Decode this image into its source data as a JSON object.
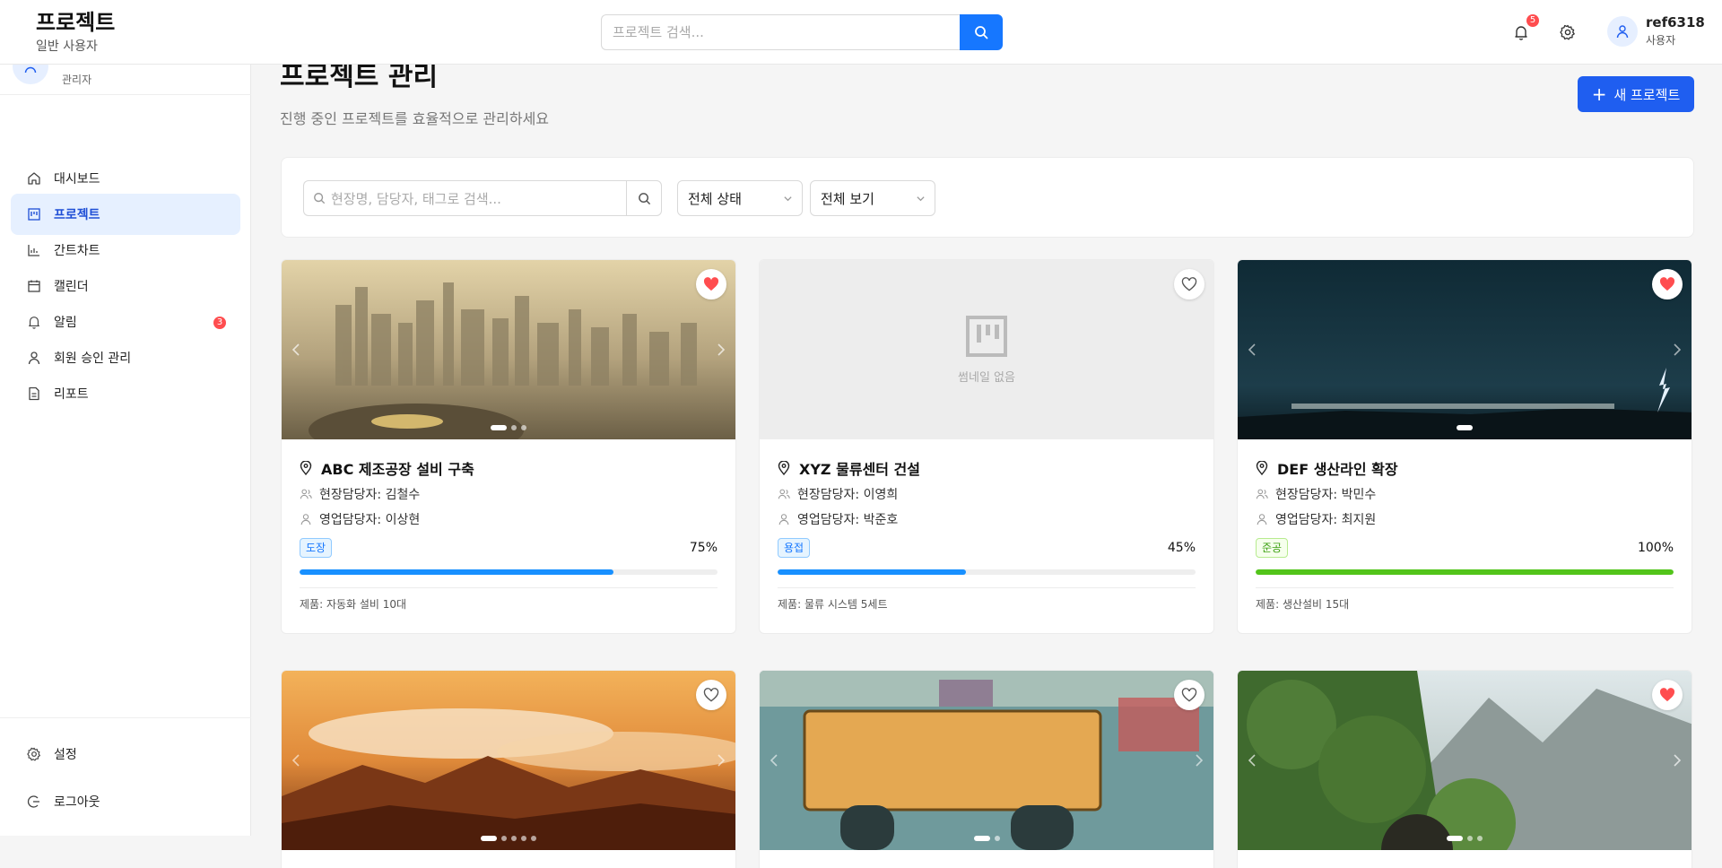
{
  "header": {
    "app_title": "프로젝트",
    "app_subtitle": "일반 사용자",
    "search_placeholder": "프로젝트 검색...",
    "notifications_count": "5",
    "user_name": "ref6318",
    "user_role": "사용자"
  },
  "sidebar": {
    "profile_role": "관리자",
    "items": [
      {
        "label": "대시보드",
        "icon": "home-icon",
        "active": false
      },
      {
        "label": "프로젝트",
        "icon": "project-icon",
        "active": true
      },
      {
        "label": "간트차트",
        "icon": "chart-icon",
        "active": false
      },
      {
        "label": "캘린더",
        "icon": "calendar-icon",
        "active": false
      },
      {
        "label": "알림",
        "icon": "bell-icon",
        "active": false,
        "badge": "3"
      },
      {
        "label": "회원 승인 관리",
        "icon": "user-icon",
        "active": false
      },
      {
        "label": "리포트",
        "icon": "report-icon",
        "active": false
      }
    ],
    "settings_label": "설정",
    "logout_label": "로그아웃"
  },
  "main": {
    "title": "프로젝트 관리",
    "subtitle": "진행 중인 프로젝트를 효율적으로 관리하세요",
    "new_button": "새 프로젝트",
    "filter_placeholder": "현장명, 담당자, 태그로 검색...",
    "status_select": "전체 상태",
    "view_select": "전체 보기"
  },
  "cards": [
    {
      "title": "ABC 제조공장 설비 구축",
      "site_manager": "현장담당자: 김철수",
      "sales_manager": "영업담당자: 이상현",
      "tag": "도장",
      "tag_color": "blue",
      "progress": 75,
      "progress_label": "75%",
      "product": "제품: 자동화 설비 10대",
      "favorite": true,
      "image": "city",
      "dots": 3
    },
    {
      "title": "XYZ 물류센터 건설",
      "site_manager": "현장담당자: 이영희",
      "sales_manager": "영업담당자: 박준호",
      "tag": "용접",
      "tag_color": "blue",
      "progress": 45,
      "progress_label": "45%",
      "product": "제품: 물류 시스템 5세트",
      "favorite": false,
      "image": "none",
      "placeholder_text": "썸네일 없음",
      "dots": 0
    },
    {
      "title": "DEF 생산라인 확장",
      "site_manager": "현장담당자: 박민수",
      "sales_manager": "영업담당자: 최지원",
      "tag": "준공",
      "tag_color": "green",
      "progress": 100,
      "progress_label": "100%",
      "product": "제품: 생산설비 15대",
      "favorite": true,
      "image": "storm",
      "dots": 1
    },
    {
      "favorite": false,
      "image": "sunset",
      "dots": 5
    },
    {
      "favorite": false,
      "image": "plate",
      "dots": 2
    },
    {
      "favorite": true,
      "image": "forest",
      "dots": 3
    }
  ],
  "colors": {
    "primary": "#1677ff",
    "progress_blue": "#1890ff",
    "progress_green": "#52c41a",
    "danger": "#ff4d4f",
    "active_bg": "#e6f0ff"
  }
}
